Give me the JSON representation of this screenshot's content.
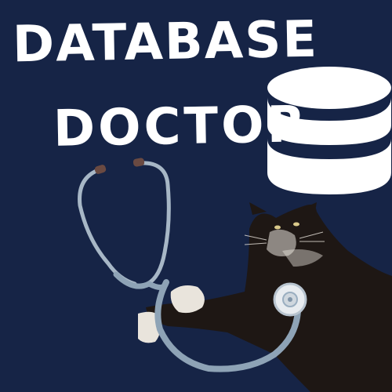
{
  "title": {
    "line1": "DATABASE",
    "line2": "DOCTOR"
  },
  "icons": {
    "database": "database-icon",
    "stethoscope": "stethoscope-icon",
    "cat": "cat-image"
  },
  "colors": {
    "background": "#162446",
    "text": "#ffffff",
    "database_icon": "#ffffff",
    "stethoscope_tube": "#9aaec0",
    "stethoscope_earpiece": "#6a4a42",
    "cat_fur": "#1e1714",
    "cat_white": "#e9e4dc"
  }
}
